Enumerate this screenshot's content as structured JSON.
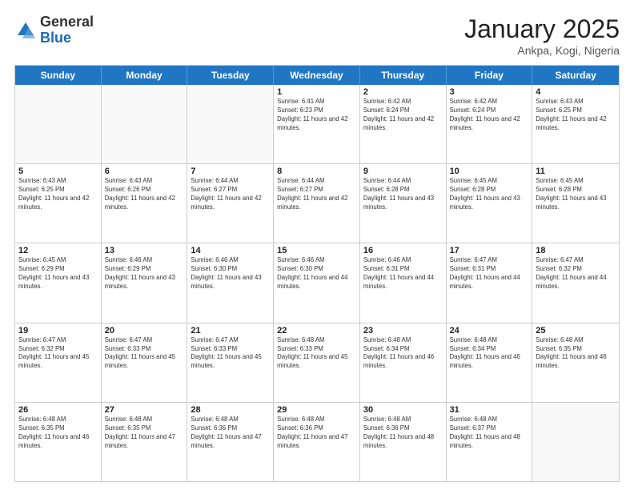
{
  "header": {
    "logo_general": "General",
    "logo_blue": "Blue",
    "title": "January 2025",
    "location": "Ankpa, Kogi, Nigeria"
  },
  "calendar": {
    "days_of_week": [
      "Sunday",
      "Monday",
      "Tuesday",
      "Wednesday",
      "Thursday",
      "Friday",
      "Saturday"
    ],
    "weeks": [
      [
        {
          "day": "",
          "empty": true
        },
        {
          "day": "",
          "empty": true
        },
        {
          "day": "",
          "empty": true
        },
        {
          "day": "1",
          "sunrise": "6:41 AM",
          "sunset": "6:23 PM",
          "daylight": "11 hours and 42 minutes."
        },
        {
          "day": "2",
          "sunrise": "6:42 AM",
          "sunset": "6:24 PM",
          "daylight": "11 hours and 42 minutes."
        },
        {
          "day": "3",
          "sunrise": "6:42 AM",
          "sunset": "6:24 PM",
          "daylight": "11 hours and 42 minutes."
        },
        {
          "day": "4",
          "sunrise": "6:43 AM",
          "sunset": "6:25 PM",
          "daylight": "11 hours and 42 minutes."
        }
      ],
      [
        {
          "day": "5",
          "sunrise": "6:43 AM",
          "sunset": "6:25 PM",
          "daylight": "11 hours and 42 minutes."
        },
        {
          "day": "6",
          "sunrise": "6:43 AM",
          "sunset": "6:26 PM",
          "daylight": "11 hours and 42 minutes."
        },
        {
          "day": "7",
          "sunrise": "6:44 AM",
          "sunset": "6:27 PM",
          "daylight": "11 hours and 42 minutes."
        },
        {
          "day": "8",
          "sunrise": "6:44 AM",
          "sunset": "6:27 PM",
          "daylight": "11 hours and 42 minutes."
        },
        {
          "day": "9",
          "sunrise": "6:44 AM",
          "sunset": "6:28 PM",
          "daylight": "11 hours and 43 minutes."
        },
        {
          "day": "10",
          "sunrise": "6:45 AM",
          "sunset": "6:28 PM",
          "daylight": "11 hours and 43 minutes."
        },
        {
          "day": "11",
          "sunrise": "6:45 AM",
          "sunset": "6:28 PM",
          "daylight": "11 hours and 43 minutes."
        }
      ],
      [
        {
          "day": "12",
          "sunrise": "6:45 AM",
          "sunset": "6:29 PM",
          "daylight": "11 hours and 43 minutes."
        },
        {
          "day": "13",
          "sunrise": "6:46 AM",
          "sunset": "6:29 PM",
          "daylight": "11 hours and 43 minutes."
        },
        {
          "day": "14",
          "sunrise": "6:46 AM",
          "sunset": "6:30 PM",
          "daylight": "11 hours and 43 minutes."
        },
        {
          "day": "15",
          "sunrise": "6:46 AM",
          "sunset": "6:30 PM",
          "daylight": "11 hours and 44 minutes."
        },
        {
          "day": "16",
          "sunrise": "6:46 AM",
          "sunset": "6:31 PM",
          "daylight": "11 hours and 44 minutes."
        },
        {
          "day": "17",
          "sunrise": "6:47 AM",
          "sunset": "6:31 PM",
          "daylight": "11 hours and 44 minutes."
        },
        {
          "day": "18",
          "sunrise": "6:47 AM",
          "sunset": "6:32 PM",
          "daylight": "11 hours and 44 minutes."
        }
      ],
      [
        {
          "day": "19",
          "sunrise": "6:47 AM",
          "sunset": "6:32 PM",
          "daylight": "11 hours and 45 minutes."
        },
        {
          "day": "20",
          "sunrise": "6:47 AM",
          "sunset": "6:33 PM",
          "daylight": "11 hours and 45 minutes."
        },
        {
          "day": "21",
          "sunrise": "6:47 AM",
          "sunset": "6:33 PM",
          "daylight": "11 hours and 45 minutes."
        },
        {
          "day": "22",
          "sunrise": "6:48 AM",
          "sunset": "6:33 PM",
          "daylight": "11 hours and 45 minutes."
        },
        {
          "day": "23",
          "sunrise": "6:48 AM",
          "sunset": "6:34 PM",
          "daylight": "11 hours and 46 minutes."
        },
        {
          "day": "24",
          "sunrise": "6:48 AM",
          "sunset": "6:34 PM",
          "daylight": "11 hours and 46 minutes."
        },
        {
          "day": "25",
          "sunrise": "6:48 AM",
          "sunset": "6:35 PM",
          "daylight": "11 hours and 46 minutes."
        }
      ],
      [
        {
          "day": "26",
          "sunrise": "6:48 AM",
          "sunset": "6:35 PM",
          "daylight": "11 hours and 46 minutes."
        },
        {
          "day": "27",
          "sunrise": "6:48 AM",
          "sunset": "6:35 PM",
          "daylight": "11 hours and 47 minutes."
        },
        {
          "day": "28",
          "sunrise": "6:48 AM",
          "sunset": "6:36 PM",
          "daylight": "11 hours and 47 minutes."
        },
        {
          "day": "29",
          "sunrise": "6:48 AM",
          "sunset": "6:36 PM",
          "daylight": "11 hours and 47 minutes."
        },
        {
          "day": "30",
          "sunrise": "6:48 AM",
          "sunset": "6:36 PM",
          "daylight": "11 hours and 48 minutes."
        },
        {
          "day": "31",
          "sunrise": "6:48 AM",
          "sunset": "6:37 PM",
          "daylight": "11 hours and 48 minutes."
        },
        {
          "day": "",
          "empty": true
        }
      ]
    ],
    "labels": {
      "sunrise": "Sunrise:",
      "sunset": "Sunset:",
      "daylight": "Daylight:"
    }
  }
}
